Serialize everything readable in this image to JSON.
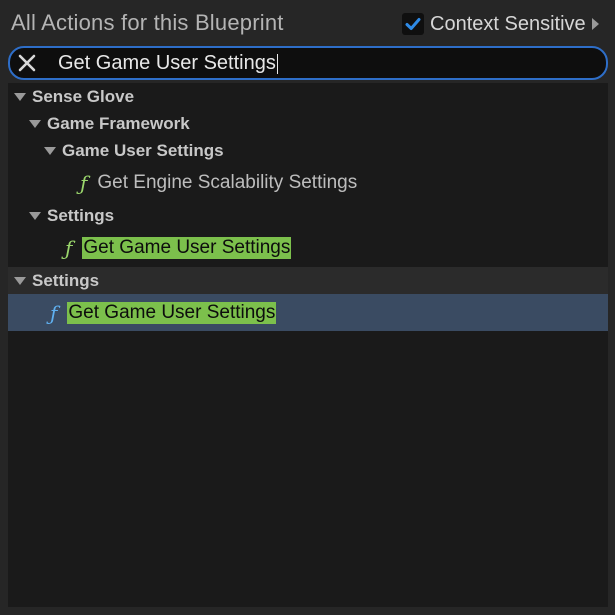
{
  "header": {
    "title": "All Actions for this Blueprint",
    "context_label": "Context Sensitive",
    "context_checked": true
  },
  "search": {
    "value": "Get Game User Settings"
  },
  "tree": {
    "sense_glove": "Sense Glove",
    "game_framework": "Game Framework",
    "game_user_settings_category": "Game User Settings",
    "get_engine_scalability": "Get Engine Scalability Settings",
    "settings_nested": "Settings",
    "get_game_user_settings_1": "Get Game User Settings",
    "settings_top": "Settings",
    "get_game_user_settings_2": "Get Game User Settings"
  },
  "colors": {
    "accent": "#2e6ec8",
    "highlight": "#7cc04c",
    "function_icon_green": "#9ad66c",
    "function_icon_blue": "#5fb0f0",
    "selected_bg": "#3a4b62"
  },
  "icons": {
    "clear": "close-icon",
    "checkbox": "check-icon",
    "expand": "triangle-down-icon",
    "function": "function-icon"
  }
}
